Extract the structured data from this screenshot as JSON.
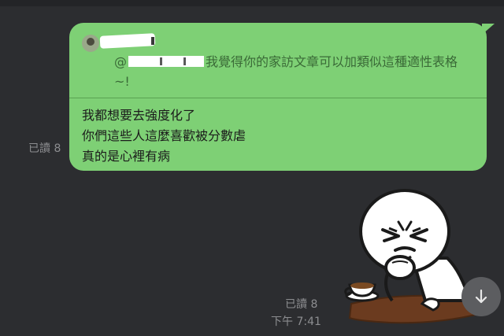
{
  "chat": {
    "message": {
      "reply_preview": {
        "at_sign": "@",
        "text": "我覺得你的家訪文章可以加類似這種適性表格~!"
      },
      "lines": [
        "我都想要去強度化了",
        "你們這些人這麼喜歡被分數虐",
        "真的是心裡有病"
      ],
      "read_label": "已讀 8"
    },
    "sticker": {
      "name": "moon-character-angry-with-coffee",
      "read_label": "已讀 8",
      "time": "下午 7:41"
    }
  },
  "controls": {
    "scroll_down_icon": "arrow-down-icon"
  },
  "colors": {
    "background": "#2c2d30",
    "bubble": "#7ed075",
    "meta_text": "#8c8d90",
    "scroll_button": "#5c5d60"
  }
}
